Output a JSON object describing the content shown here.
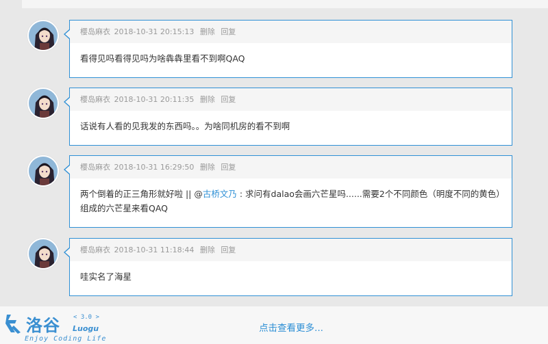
{
  "comments": [
    {
      "author": "樱岛麻衣",
      "time": "2018-10-31 20:15:13",
      "delete_label": "删除",
      "reply_label": "回复",
      "text": "看得见吗看得见吗为啥犇犇里看不到啊QAQ"
    },
    {
      "author": "樱岛麻衣",
      "time": "2018-10-31 20:11:35",
      "delete_label": "删除",
      "reply_label": "回复",
      "text": "话说有人看的见我发的东西吗。。为啥同机房的看不到啊"
    },
    {
      "author": "樱岛麻衣",
      "time": "2018-10-31 16:29:50",
      "delete_label": "删除",
      "reply_label": "回复",
      "text_before": "两个倒着的正三角形就好啦 || @",
      "mention": "古桥文乃",
      "text_after": " : 求问有dalao会画六芒星吗......需要2个不同颜色（明度不同的黄色）组成的六芒星来看QAQ"
    },
    {
      "author": "樱岛麻衣",
      "time": "2018-10-31 11:18:44",
      "delete_label": "删除",
      "reply_label": "回复",
      "text": "哇实名了海星"
    }
  ],
  "load_more": "点击查看更多...",
  "logo": {
    "cn": "洛谷",
    "version": "< 3.0 >",
    "en": "Luogu",
    "tagline": "Enjoy Coding Life"
  },
  "colors": {
    "accent": "#2d8fd5",
    "background": "#e8e8e8",
    "meta_bg": "#f5f5f5"
  }
}
